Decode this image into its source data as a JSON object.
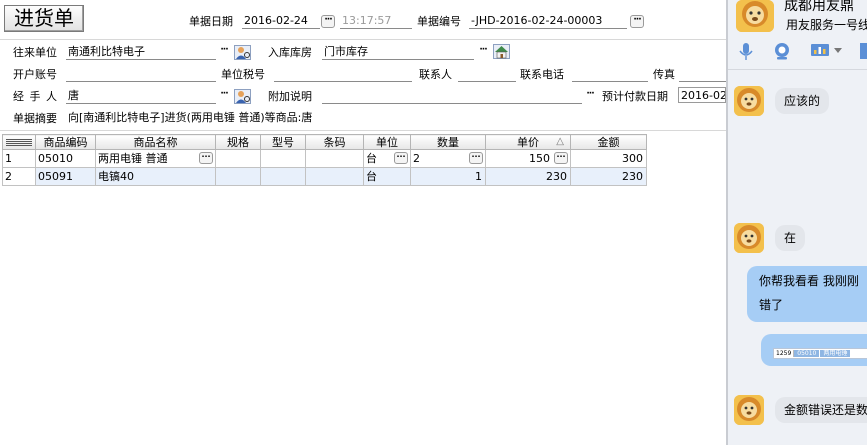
{
  "form": {
    "title": "进货单",
    "date_label": "单据日期",
    "date_value": "2016-02-24",
    "time_value": "13:17:57",
    "docno_label": "单据编号",
    "docno_value": "-JHD-2016-02-24-00003",
    "partner_label": "往来单位",
    "partner_value": "南通利比特电子",
    "warehouse_label": "入库库房",
    "warehouse_value": "门市库存",
    "account_label": "开户账号",
    "taxno_label": "单位税号",
    "contact_label": "联系人",
    "phone_label": "联系电话",
    "fax_label": "传真",
    "handler_label": "经 手 人",
    "handler_value": "唐",
    "note_label": "附加说明",
    "paydate_label": "预计付款日期",
    "paydate_value": "2016-02-",
    "summary_label": "单据摘要",
    "summary_value": "向[南通利比特电子]进货(两用电锤 普通)等商品:唐"
  },
  "grid": {
    "headers": [
      "商品编码",
      "商品名称",
      "规格",
      "型号",
      "条码",
      "单位",
      "数量",
      "单价",
      "金额"
    ],
    "sort_mark": "△",
    "rows": [
      {
        "idx": "1",
        "code": "05010",
        "name": "两用电锤 普通",
        "spec": "",
        "model": "",
        "barcode": "",
        "unit": "台",
        "qty": "2",
        "price": "150",
        "amount": "300"
      },
      {
        "idx": "2",
        "code": "05091",
        "name": "电镐40",
        "spec": "",
        "model": "",
        "barcode": "",
        "unit": "台",
        "qty": "1",
        "price": "230",
        "amount": "230"
      }
    ]
  },
  "chat": {
    "header_name": "成都用友鼎",
    "header_sub": "用友服务一号线",
    "messages": [
      {
        "from": "them",
        "text": "应该的"
      },
      {
        "from": "them",
        "text": "在"
      },
      {
        "from": "me",
        "line1": "你帮我看看  我刚刚",
        "line2": "错了"
      },
      {
        "from": "me",
        "thumb_text_a": "1259",
        "thumb_text_b": "05010",
        "thumb_text_c": "两用电锤"
      },
      {
        "from": "them",
        "text": "金额错误还是数"
      }
    ],
    "colors": {
      "panel": "#eef1f6",
      "my_bubble": "#a6cdf5",
      "their_bubble": "#e3e6eb"
    }
  }
}
